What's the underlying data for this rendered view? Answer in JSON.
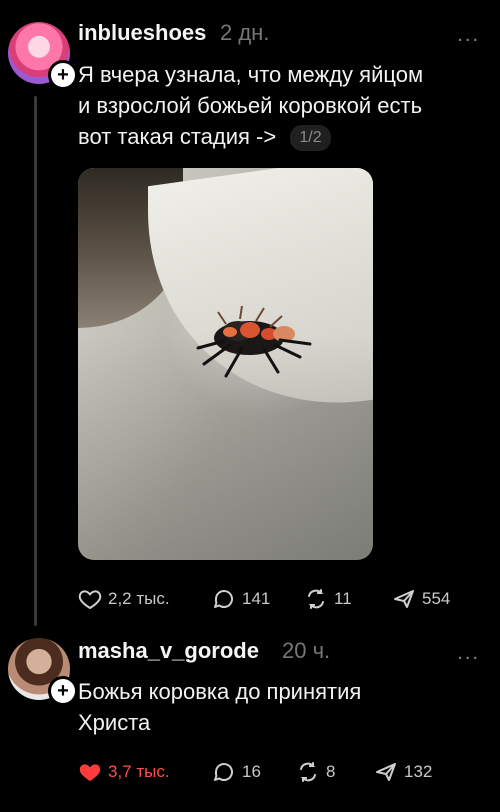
{
  "posts": [
    {
      "username": "inblueshoes",
      "time": "2 дн.",
      "text_lines": [
        "Я вчера узнала, что между яйцом",
        "и взрослой божьей коровкой есть",
        "вот такая стадия ->"
      ],
      "page_indicator": "1/2",
      "stats": {
        "likes": "2,2 тыс.",
        "comments": "141",
        "reposts": "11",
        "shares": "554"
      }
    },
    {
      "username": "masha_v_gorode",
      "time": "20 ч.",
      "text_lines": [
        "Божья коровка до принятия",
        "Христа"
      ],
      "stats": {
        "likes": "3,7 тыс.",
        "comments": "16",
        "reposts": "8",
        "shares": "132"
      }
    }
  ],
  "ui": {
    "more_label": "...",
    "plus": "+"
  }
}
